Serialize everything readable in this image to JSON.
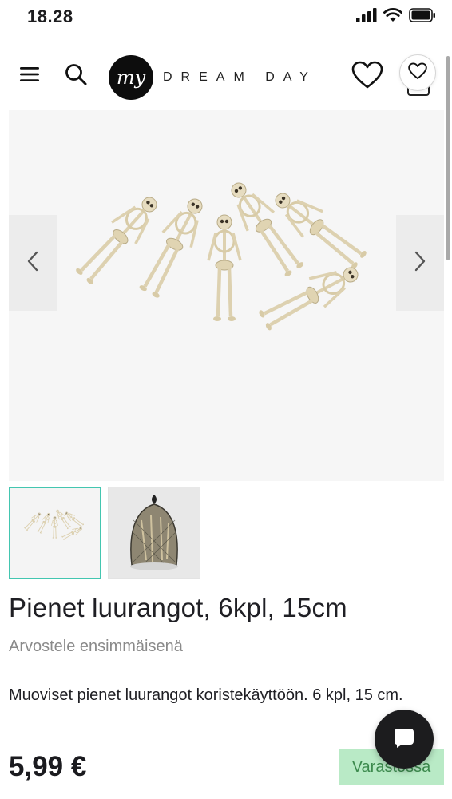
{
  "status_bar": {
    "time": "18.28",
    "icons": [
      "signal-icon",
      "wifi-icon",
      "battery-icon"
    ]
  },
  "header": {
    "logo_mark": "my",
    "logo_text": "DREAM DAY",
    "icons": [
      "menu-icon",
      "search-icon",
      "heart-icon",
      "cart-icon"
    ]
  },
  "gallery": {
    "prev_icon": "chevron-left-icon",
    "next_icon": "chevron-right-icon",
    "thumbnails": [
      "skeletons-thumbnail",
      "skeletons-in-bag-thumbnail"
    ],
    "active_thumbnail": 0
  },
  "product": {
    "title": "Pienet luurangot, 6kpl, 15cm",
    "review_link": "Arvostele ensimmäisenä",
    "description": "Muoviset pienet luurangot koristekäyttöön. 6 kpl, 15 cm.",
    "price": "5,99 €",
    "stock_status": "Varastossa"
  },
  "colors": {
    "accent_teal": "#43c6b0",
    "stock_bg": "#b9eac6",
    "stock_text": "#3c8a4d",
    "chat_bg": "#1c1c1e"
  }
}
